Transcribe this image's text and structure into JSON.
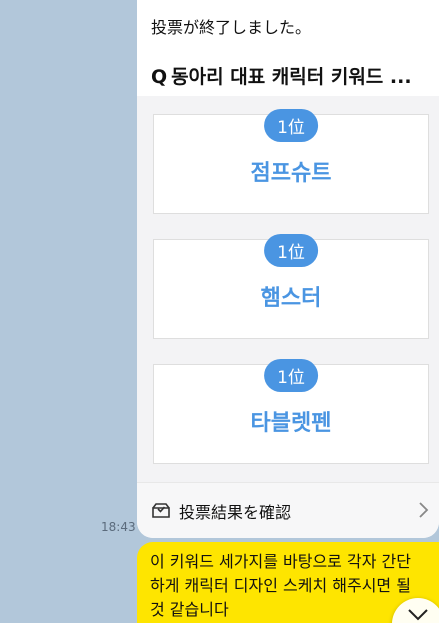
{
  "poll": {
    "status": "投票が終了しました。",
    "question_mark": "Q",
    "question": "동아리 대표 캐릭터 키워드 ...",
    "options": [
      {
        "rank": "1位",
        "label": "점프슈트"
      },
      {
        "rank": "1位",
        "label": "햄스터"
      },
      {
        "rank": "1位",
        "label": "타블렛펜"
      }
    ],
    "results_label": "投票結果を確認",
    "icons": {
      "results": "ballot-box-icon",
      "chevron": "chevron-right-icon"
    }
  },
  "timestamp": "18:43",
  "message": {
    "lines": [
      "이 키워드 세가지를 바탕으로 각자 간단",
      "하게 캐릭터 디자인 스케치 해주시면 될",
      "것 같습니다"
    ]
  },
  "colors": {
    "background": "#b2c7da",
    "accent": "#4a95e2",
    "bubble": "#fee500"
  }
}
